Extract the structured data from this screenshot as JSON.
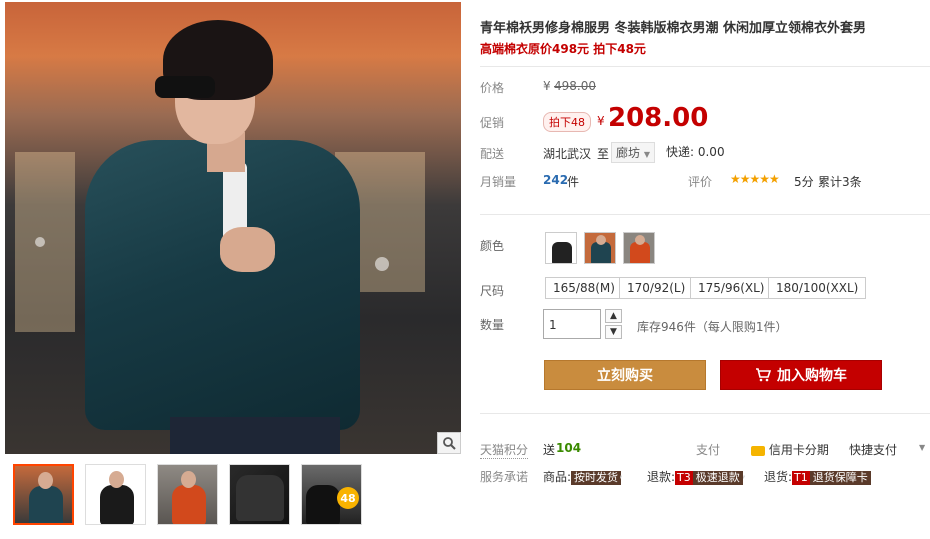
{
  "product": {
    "title": "青年棉袄男修身棉服男 冬装韩版棉衣男潮 休闲加厚立领棉衣外套男",
    "subtitle": "高端棉衣原价498元 拍下48元"
  },
  "price": {
    "label": "价格",
    "currency": "¥",
    "original": "498.00",
    "promo_label": "促销",
    "promo_tag": "拍下48",
    "promo_price": "208.00"
  },
  "shipping": {
    "label": "配送",
    "origin": "湖北武汉",
    "to": "至",
    "destination": "廊坊",
    "express": "快递: 0.00"
  },
  "sales": {
    "label": "月销量",
    "count": "242",
    "unit": "件",
    "rating_label": "评价",
    "stars": "★★★★★",
    "score": "5分",
    "reviews": "累计3条"
  },
  "color": {
    "label": "颜色"
  },
  "size": {
    "label": "尺码",
    "options": [
      "165/88(M)",
      "170/92(L)",
      "175/96(XL)",
      "180/100(XXL)"
    ]
  },
  "quantity": {
    "label": "数量",
    "value": "1",
    "stock": "库存946件（每人限购1件）"
  },
  "actions": {
    "buy_now": "立刻购买",
    "add_cart": "加入购物车"
  },
  "points": {
    "label": "天猫积分",
    "give": "送",
    "amount": "104"
  },
  "payment": {
    "label": "支付",
    "credit": "信用卡分期",
    "quick": "快捷支付"
  },
  "service": {
    "label": "服务承诺",
    "goods": "商品:",
    "goods_tag": "按时发货",
    "refund": "退款:",
    "refund_num": "T3",
    "refund_tag": "极速退款",
    "return": "退货:",
    "return_num": "T1",
    "return_tag": "退货保障卡"
  },
  "thumb_badge": "48",
  "colors": {
    "accent_red": "#c40000",
    "buy_button": "#c98c3e",
    "star": "#f3a000"
  }
}
